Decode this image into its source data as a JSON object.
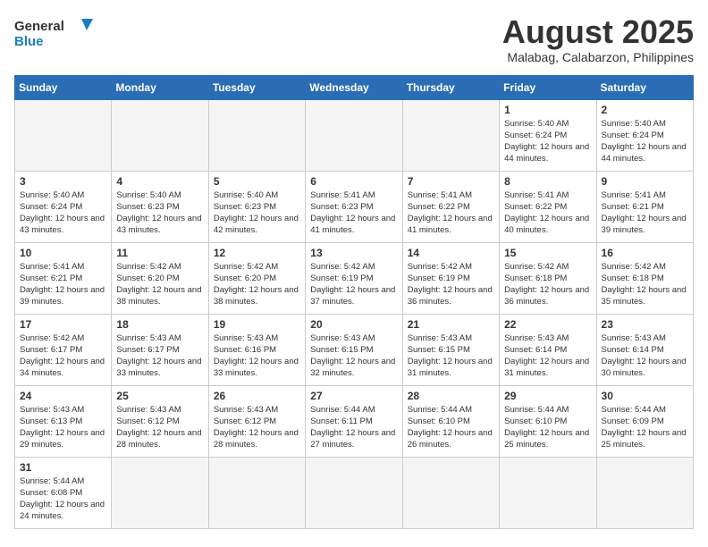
{
  "header": {
    "logo_line1": "General",
    "logo_line2": "Blue",
    "title": "August 2025",
    "subtitle": "Malabag, Calabarzon, Philippines"
  },
  "days_of_week": [
    "Sunday",
    "Monday",
    "Tuesday",
    "Wednesday",
    "Thursday",
    "Friday",
    "Saturday"
  ],
  "weeks": [
    [
      {
        "day": "",
        "empty": true
      },
      {
        "day": "",
        "empty": true
      },
      {
        "day": "",
        "empty": true
      },
      {
        "day": "",
        "empty": true
      },
      {
        "day": "",
        "empty": true
      },
      {
        "day": "1",
        "sunrise": "Sunrise: 5:40 AM",
        "sunset": "Sunset: 6:24 PM",
        "daylight": "Daylight: 12 hours and 44 minutes."
      },
      {
        "day": "2",
        "sunrise": "Sunrise: 5:40 AM",
        "sunset": "Sunset: 6:24 PM",
        "daylight": "Daylight: 12 hours and 44 minutes."
      }
    ],
    [
      {
        "day": "3",
        "sunrise": "Sunrise: 5:40 AM",
        "sunset": "Sunset: 6:24 PM",
        "daylight": "Daylight: 12 hours and 43 minutes."
      },
      {
        "day": "4",
        "sunrise": "Sunrise: 5:40 AM",
        "sunset": "Sunset: 6:23 PM",
        "daylight": "Daylight: 12 hours and 43 minutes."
      },
      {
        "day": "5",
        "sunrise": "Sunrise: 5:40 AM",
        "sunset": "Sunset: 6:23 PM",
        "daylight": "Daylight: 12 hours and 42 minutes."
      },
      {
        "day": "6",
        "sunrise": "Sunrise: 5:41 AM",
        "sunset": "Sunset: 6:23 PM",
        "daylight": "Daylight: 12 hours and 41 minutes."
      },
      {
        "day": "7",
        "sunrise": "Sunrise: 5:41 AM",
        "sunset": "Sunset: 6:22 PM",
        "daylight": "Daylight: 12 hours and 41 minutes."
      },
      {
        "day": "8",
        "sunrise": "Sunrise: 5:41 AM",
        "sunset": "Sunset: 6:22 PM",
        "daylight": "Daylight: 12 hours and 40 minutes."
      },
      {
        "day": "9",
        "sunrise": "Sunrise: 5:41 AM",
        "sunset": "Sunset: 6:21 PM",
        "daylight": "Daylight: 12 hours and 39 minutes."
      }
    ],
    [
      {
        "day": "10",
        "sunrise": "Sunrise: 5:41 AM",
        "sunset": "Sunset: 6:21 PM",
        "daylight": "Daylight: 12 hours and 39 minutes."
      },
      {
        "day": "11",
        "sunrise": "Sunrise: 5:42 AM",
        "sunset": "Sunset: 6:20 PM",
        "daylight": "Daylight: 12 hours and 38 minutes."
      },
      {
        "day": "12",
        "sunrise": "Sunrise: 5:42 AM",
        "sunset": "Sunset: 6:20 PM",
        "daylight": "Daylight: 12 hours and 38 minutes."
      },
      {
        "day": "13",
        "sunrise": "Sunrise: 5:42 AM",
        "sunset": "Sunset: 6:19 PM",
        "daylight": "Daylight: 12 hours and 37 minutes."
      },
      {
        "day": "14",
        "sunrise": "Sunrise: 5:42 AM",
        "sunset": "Sunset: 6:19 PM",
        "daylight": "Daylight: 12 hours and 36 minutes."
      },
      {
        "day": "15",
        "sunrise": "Sunrise: 5:42 AM",
        "sunset": "Sunset: 6:18 PM",
        "daylight": "Daylight: 12 hours and 36 minutes."
      },
      {
        "day": "16",
        "sunrise": "Sunrise: 5:42 AM",
        "sunset": "Sunset: 6:18 PM",
        "daylight": "Daylight: 12 hours and 35 minutes."
      }
    ],
    [
      {
        "day": "17",
        "sunrise": "Sunrise: 5:42 AM",
        "sunset": "Sunset: 6:17 PM",
        "daylight": "Daylight: 12 hours and 34 minutes."
      },
      {
        "day": "18",
        "sunrise": "Sunrise: 5:43 AM",
        "sunset": "Sunset: 6:17 PM",
        "daylight": "Daylight: 12 hours and 33 minutes."
      },
      {
        "day": "19",
        "sunrise": "Sunrise: 5:43 AM",
        "sunset": "Sunset: 6:16 PM",
        "daylight": "Daylight: 12 hours and 33 minutes."
      },
      {
        "day": "20",
        "sunrise": "Sunrise: 5:43 AM",
        "sunset": "Sunset: 6:15 PM",
        "daylight": "Daylight: 12 hours and 32 minutes."
      },
      {
        "day": "21",
        "sunrise": "Sunrise: 5:43 AM",
        "sunset": "Sunset: 6:15 PM",
        "daylight": "Daylight: 12 hours and 31 minutes."
      },
      {
        "day": "22",
        "sunrise": "Sunrise: 5:43 AM",
        "sunset": "Sunset: 6:14 PM",
        "daylight": "Daylight: 12 hours and 31 minutes."
      },
      {
        "day": "23",
        "sunrise": "Sunrise: 5:43 AM",
        "sunset": "Sunset: 6:14 PM",
        "daylight": "Daylight: 12 hours and 30 minutes."
      }
    ],
    [
      {
        "day": "24",
        "sunrise": "Sunrise: 5:43 AM",
        "sunset": "Sunset: 6:13 PM",
        "daylight": "Daylight: 12 hours and 29 minutes."
      },
      {
        "day": "25",
        "sunrise": "Sunrise: 5:43 AM",
        "sunset": "Sunset: 6:12 PM",
        "daylight": "Daylight: 12 hours and 28 minutes."
      },
      {
        "day": "26",
        "sunrise": "Sunrise: 5:43 AM",
        "sunset": "Sunset: 6:12 PM",
        "daylight": "Daylight: 12 hours and 28 minutes."
      },
      {
        "day": "27",
        "sunrise": "Sunrise: 5:44 AM",
        "sunset": "Sunset: 6:11 PM",
        "daylight": "Daylight: 12 hours and 27 minutes."
      },
      {
        "day": "28",
        "sunrise": "Sunrise: 5:44 AM",
        "sunset": "Sunset: 6:10 PM",
        "daylight": "Daylight: 12 hours and 26 minutes."
      },
      {
        "day": "29",
        "sunrise": "Sunrise: 5:44 AM",
        "sunset": "Sunset: 6:10 PM",
        "daylight": "Daylight: 12 hours and 25 minutes."
      },
      {
        "day": "30",
        "sunrise": "Sunrise: 5:44 AM",
        "sunset": "Sunset: 6:09 PM",
        "daylight": "Daylight: 12 hours and 25 minutes."
      }
    ],
    [
      {
        "day": "31",
        "sunrise": "Sunrise: 5:44 AM",
        "sunset": "Sunset: 6:08 PM",
        "daylight": "Daylight: 12 hours and 24 minutes."
      },
      {
        "day": "",
        "empty": true
      },
      {
        "day": "",
        "empty": true
      },
      {
        "day": "",
        "empty": true
      },
      {
        "day": "",
        "empty": true
      },
      {
        "day": "",
        "empty": true
      },
      {
        "day": "",
        "empty": true
      }
    ]
  ]
}
